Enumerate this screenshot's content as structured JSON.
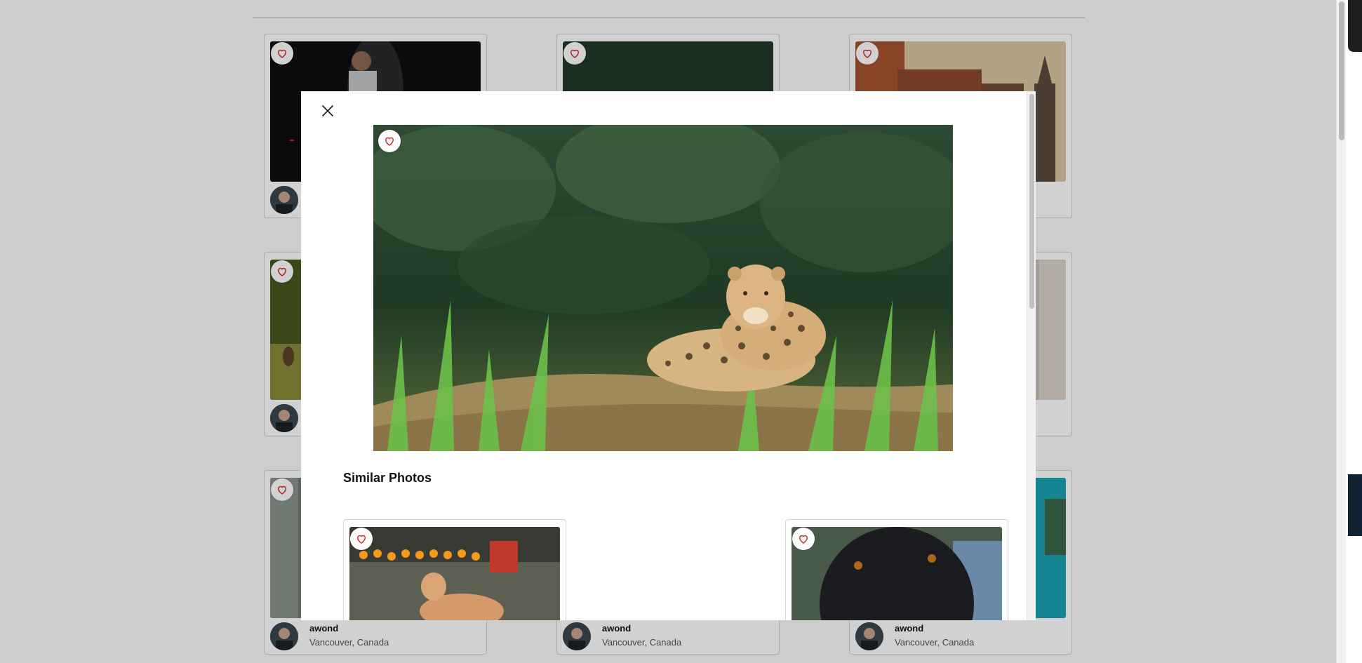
{
  "gallery": {
    "cards": [
      {
        "author": "",
        "location": ""
      },
      {
        "author": "",
        "location": ""
      },
      {
        "author": "",
        "location": ""
      },
      {
        "author": "",
        "location": ""
      },
      {
        "author": "",
        "location": ""
      },
      {
        "author": "",
        "location": ""
      },
      {
        "author": "awond",
        "location": "Vancouver, Canada"
      },
      {
        "author": "awond",
        "location": "Vancouver, Canada"
      },
      {
        "author": "awond",
        "location": "Vancouver, Canada"
      }
    ]
  },
  "modal": {
    "similar_title": "Similar Photos",
    "main_photo_subject": "jaguar resting in grass",
    "similar_photos": [
      {
        "subject": "tan dog lying on grass"
      },
      {
        "subject": "black dog close-up"
      }
    ]
  },
  "icons": {
    "favorite": "heart-icon",
    "close": "close-icon"
  },
  "colors": {
    "heart_stroke": "#d32f2f",
    "overlay": "rgba(0,0,0,0.18)"
  }
}
